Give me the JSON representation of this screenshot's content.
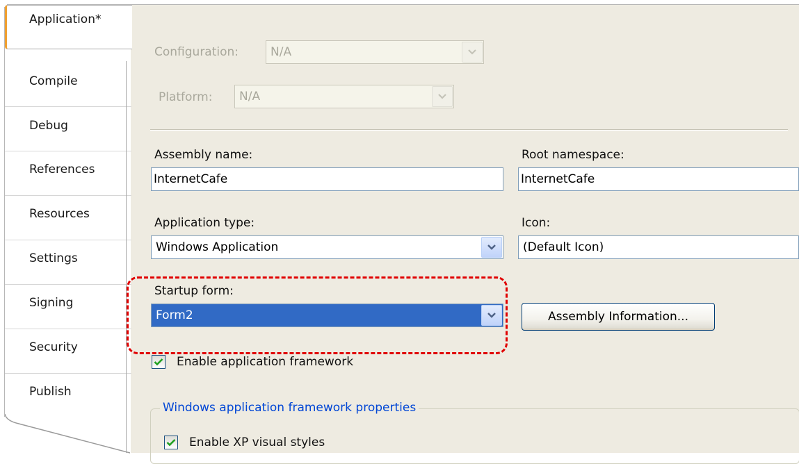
{
  "sidebar": {
    "tabs": [
      {
        "label": "Application*",
        "active": true
      },
      {
        "label": "Compile"
      },
      {
        "label": "Debug"
      },
      {
        "label": "References"
      },
      {
        "label": "Resources"
      },
      {
        "label": "Settings"
      },
      {
        "label": "Signing"
      },
      {
        "label": "Security"
      },
      {
        "label": "Publish"
      }
    ]
  },
  "config": {
    "configuration_label": "Configuration:",
    "configuration_value": "N/A",
    "platform_label": "Platform:",
    "platform_value": "N/A"
  },
  "form": {
    "assembly_name_label": "Assembly name:",
    "assembly_name_value": "InternetCafe",
    "root_namespace_label": "Root namespace:",
    "root_namespace_value": "InternetCafe",
    "application_type_label": "Application type:",
    "application_type_value": "Windows Application",
    "icon_label": "Icon:",
    "icon_value": "(Default Icon)",
    "startup_form_label": "Startup form:",
    "startup_form_value": "Form2",
    "assembly_info_button": "Assembly Information...",
    "enable_framework_label": "Enable application framework",
    "enable_framework_checked": true
  },
  "framework_group": {
    "title": "Windows application framework properties",
    "enable_xp_styles_label": "Enable XP visual styles",
    "enable_xp_styles_checked": true
  },
  "colors": {
    "highlight_dashed": "#e00000",
    "selection_blue": "#316ac5",
    "panel_bg": "#eeebe1",
    "active_tab_accent": "#f0a030",
    "group_title": "#0046d5"
  }
}
